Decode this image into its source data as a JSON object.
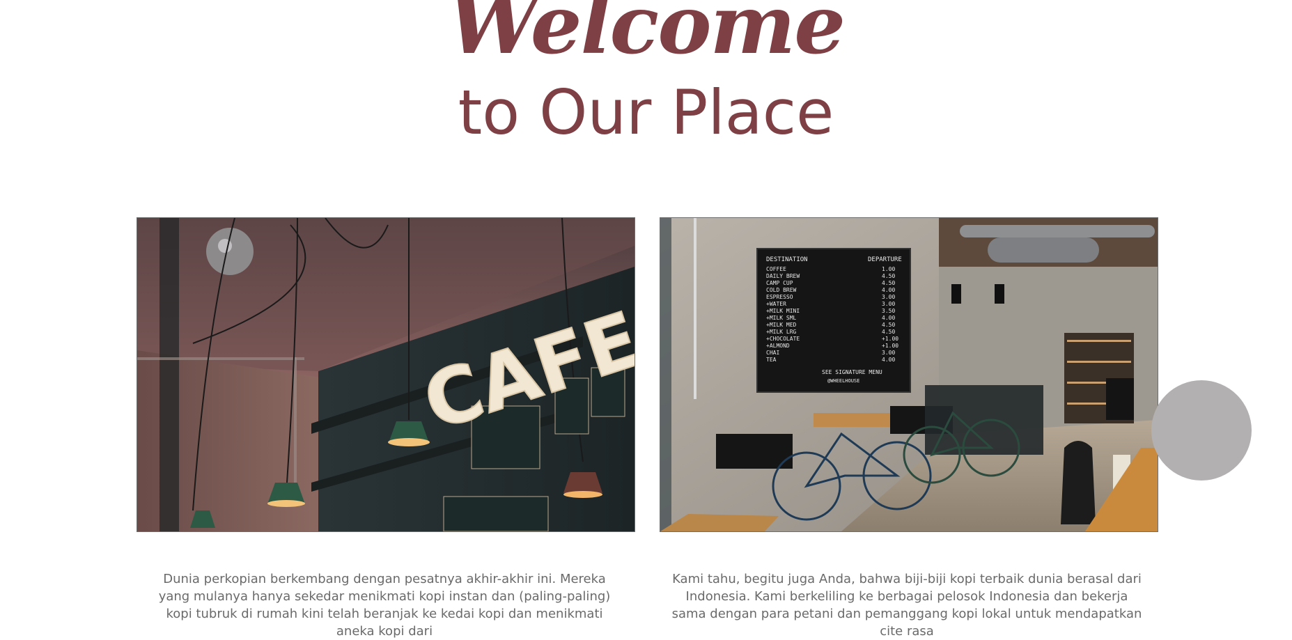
{
  "hero": {
    "title": "Welcome",
    "subtitle": "to Our Place"
  },
  "images": {
    "left": {
      "sign_text": "CAFE",
      "icon": "cafe-interior-photo"
    },
    "right": {
      "board_header_left": "DESTINATION",
      "board_header_right": "DEPARTURE",
      "board_items": [
        "COFFEE",
        "DAILY BREW",
        "CAMP CUP",
        "COLD BREW",
        "ESPRESSO",
        "+WATER",
        "+MILK MINI",
        "+MILK SML",
        "+MILK MED",
        "+MILK LRG",
        "+CHOCOLATE",
        "+ALMOND",
        "CHAI",
        "TEA"
      ],
      "board_prices": [
        "1.00",
        "4.50",
        "4.50",
        "4.00",
        "3.00",
        "3.00",
        "3.50",
        "4.00",
        "4.50",
        "4.50",
        "+1.00",
        "+1.00",
        "3.00",
        "4.00"
      ],
      "board_footer": "SEE SIGNATURE MENU",
      "board_footer_small": "@WHEELHOUSE",
      "icon": "coffee-shop-interior-photo"
    }
  },
  "paragraphs": {
    "left": "Dunia perkopian berkembang dengan pesatnya akhir-akhir ini. Mereka yang mulanya hanya sekedar menikmati kopi instan dan (paling-paling) kopi tubruk di rumah kini telah beranjak ke kedai kopi dan menikmati aneka kopi dari",
    "right": "Kami tahu, begitu juga Anda, bahwa biji-biji kopi terbaik dunia berasal dari Indonesia. Kami berkeliling ke berbagai pelosok Indonesia dan bekerja sama dengan para petani dan pemanggang kopi lokal untuk mendapatkan cite rasa"
  },
  "colors": {
    "accent": "#7e3f45",
    "body_text": "#6a6a6a",
    "floating_circle": "#b2b0b1"
  }
}
